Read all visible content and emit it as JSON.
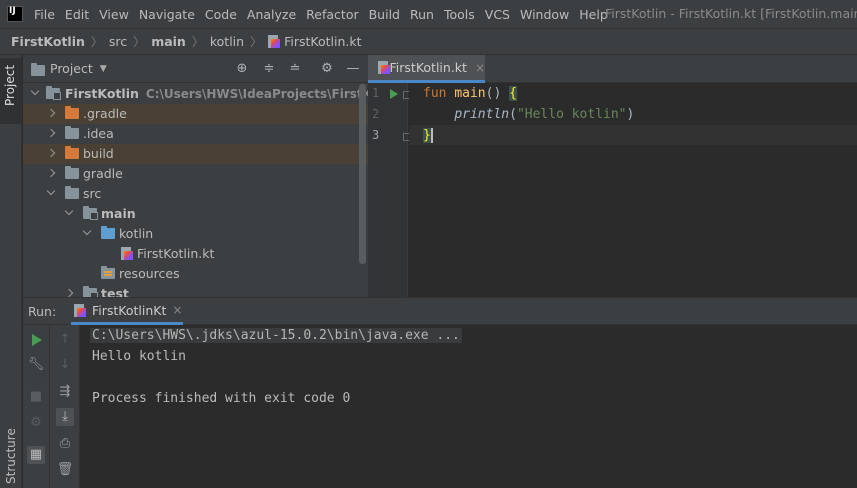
{
  "menubar": {
    "items": [
      "File",
      "Edit",
      "View",
      "Navigate",
      "Code",
      "Analyze",
      "Refactor",
      "Build",
      "Run",
      "Tools",
      "VCS",
      "Window",
      "Help"
    ],
    "window_title": "FirstKotlin - FirstKotlin.kt [FirstKotlin.main]"
  },
  "breadcrumb": {
    "items": [
      "FirstKotlin",
      "src",
      "main",
      "kotlin",
      "FirstKotlin.kt"
    ]
  },
  "left_strip": {
    "project_tab": "Project",
    "structure_tab": "Structure"
  },
  "project_panel": {
    "title": "Project",
    "header_icons": [
      "locate-icon",
      "expand-all-icon",
      "collapse-all-icon",
      "gear-icon",
      "minimize-icon"
    ],
    "tree": [
      {
        "label": "FirstKotlin",
        "path": "C:\\Users\\HWS\\IdeaProjects\\FirstKotlin",
        "expanded": true,
        "icon": "module-folder-icon"
      },
      {
        "label": ".gradle",
        "expanded": false,
        "icon": "excluded-folder-icon"
      },
      {
        "label": ".idea",
        "expanded": false,
        "icon": "folder-icon"
      },
      {
        "label": "build",
        "expanded": false,
        "icon": "excluded-folder-icon"
      },
      {
        "label": "gradle",
        "expanded": false,
        "icon": "folder-icon"
      },
      {
        "label": "src",
        "expanded": true,
        "icon": "folder-icon"
      },
      {
        "label": "main",
        "expanded": true,
        "icon": "module-folder-icon"
      },
      {
        "label": "kotlin",
        "expanded": true,
        "icon": "source-folder-icon"
      },
      {
        "label": "FirstKotlin.kt",
        "icon": "kotlin-file-icon"
      },
      {
        "label": "resources",
        "icon": "resources-folder-icon"
      },
      {
        "label": "test",
        "expanded": false,
        "icon": "module-folder-icon"
      }
    ]
  },
  "editor": {
    "tab_label": "FirstKotlin.kt",
    "tab_close": "×",
    "line_numbers": [
      "1",
      "2",
      "3"
    ],
    "code": {
      "line1_kw": "fun",
      "line1_name": "main",
      "line1_parens": "() ",
      "line1_brace": "{",
      "line2_indent": "    ",
      "line2_call": "println",
      "line2_open": "(",
      "line2_str": "\"Hello kotlin\"",
      "line2_close": ")",
      "line3_brace": "}"
    }
  },
  "run_panel": {
    "label": "Run:",
    "tab_label": "FirstKotlinKt",
    "tab_close": "×",
    "console_lines": [
      "C:\\Users\\HWS\\.jdks\\azul-15.0.2\\bin\\java.exe ...",
      "Hello kotlin",
      "",
      "Process finished with exit code 0"
    ]
  },
  "colors": {
    "background": "#2b2b2b",
    "panel": "#3c3f41",
    "accent": "#4a88c7",
    "keyword": "#cc7832",
    "function": "#ffc66d",
    "string": "#6a8759",
    "run_green": "#499c54"
  }
}
